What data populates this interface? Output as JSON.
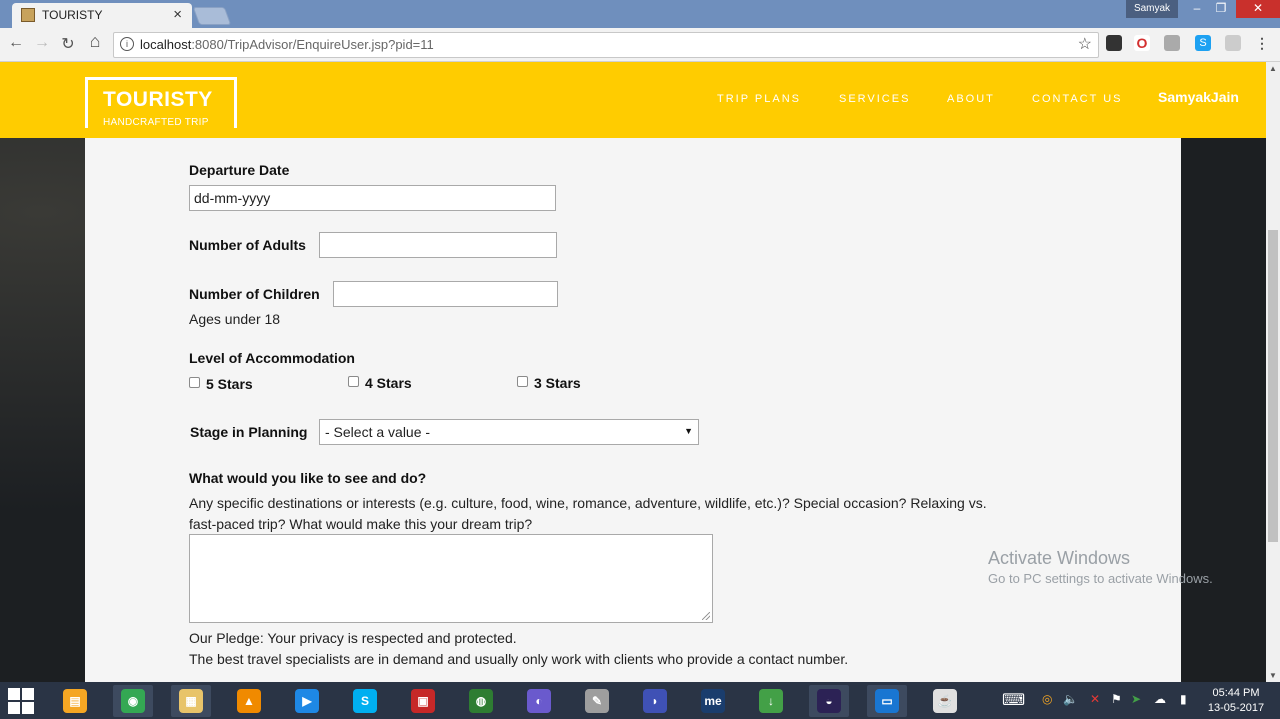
{
  "browser": {
    "tab_title": "TOURISTY",
    "tab_close": "×",
    "user_badge": "Samyak",
    "win_min": "–",
    "win_max": "❐",
    "win_close": "✕",
    "back": "←",
    "forward": "→",
    "reload": "↻",
    "home": "⌂",
    "info": "i",
    "url_host": "localhost",
    "url_path": ":8080/TripAdvisor/EnquireUser.jsp?pid=11",
    "star": "☆"
  },
  "header": {
    "logo_name": "TOURISTY",
    "logo_tagline": "HANDCRAFTED TRIP",
    "nav": {
      "trip_plans": "TRIP PLANS",
      "services": "SERVICES",
      "about": "ABOUT",
      "contact_us": "CONTACT US"
    },
    "user": "SamyakJain"
  },
  "form": {
    "departure_label": "Departure Date",
    "departure_value": "dd-mm-yyyy",
    "adults_label": "Number of Adults",
    "adults_value": "",
    "children_label": "Number of Children",
    "children_value": "",
    "children_note": "Ages under 18",
    "accommodation_label": "Level of Accommodation",
    "accommodation_options": [
      "5 Stars",
      "4 Stars",
      "3 Stars"
    ],
    "stage_label": "Stage in Planning",
    "stage_value": "- Select a value -",
    "stage_arrow": "▼",
    "wishes_label": "What would you like to see and do?",
    "wishes_help_line1": "Any specific destinations or interests (e.g. culture, food, wine, romance, adventure, wildlife, etc.)? Special occasion? Relaxing vs.",
    "wishes_help_line2": "fast-paced trip? What would make this your dream trip?",
    "wishes_value": "",
    "pledge_line1": "Our Pledge: Your privacy is respected and protected.",
    "pledge_line2": "The best travel specialists are in demand and usually only work with clients who provide a contact number."
  },
  "watermark": {
    "line1": "Activate Windows",
    "line2": "Go to PC settings to activate Windows."
  },
  "scrollbar": {
    "up": "▲",
    "down": "▼"
  },
  "taskbar": {
    "apps": [
      {
        "name": "file-manager-icon",
        "glyph": "▤",
        "color": "#f5a623"
      },
      {
        "name": "chrome-icon",
        "glyph": "◉",
        "color": "#34a853"
      },
      {
        "name": "explorer-icon",
        "glyph": "▦",
        "color": "#e8c46a"
      },
      {
        "name": "vlc-icon",
        "glyph": "▲",
        "color": "#f08a00"
      },
      {
        "name": "media-player-icon",
        "glyph": "▶",
        "color": "#1e88e5"
      },
      {
        "name": "skype-icon",
        "glyph": "S",
        "color": "#00aff0"
      },
      {
        "name": "screen-recorder-icon",
        "glyph": "▣",
        "color": "#c62828"
      },
      {
        "name": "network-app-icon",
        "glyph": "◍",
        "color": "#2e7d32"
      },
      {
        "name": "browser-app-icon",
        "glyph": "◐",
        "color": "#6a5acd"
      },
      {
        "name": "notepad-icon",
        "glyph": "✎",
        "color": "#9e9e9e"
      },
      {
        "name": "dolphin-app-icon",
        "glyph": "◗",
        "color": "#3f51b5"
      },
      {
        "name": "me-app-icon",
        "glyph": "me",
        "color": "#1a3d6d"
      },
      {
        "name": "jdownloader-icon",
        "glyph": "↓",
        "color": "#43a047"
      },
      {
        "name": "eclipse-icon",
        "glyph": "◒",
        "color": "#2c2255"
      },
      {
        "name": "display-app-icon",
        "glyph": "▭",
        "color": "#1976d2"
      },
      {
        "name": "java-icon",
        "glyph": "☕",
        "color": "#e0e0e0"
      }
    ],
    "tray": {
      "keyboard": "⌨",
      "circle": "◎",
      "volume": "🔈",
      "network": "✕",
      "flag": "⚑",
      "arrow": "➤",
      "cloud": "☁",
      "battery": "▮"
    },
    "time": "05:44 PM",
    "date": "13-05-2017"
  }
}
